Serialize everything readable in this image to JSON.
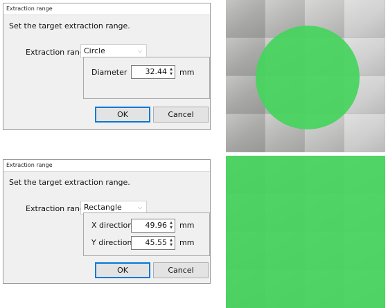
{
  "dialog_circle": {
    "title": "Extraction range",
    "instruction": "Set the target extraction range.",
    "range_label": "Extraction range:",
    "shape_selected": "Circle",
    "diameter_label": "Diameter",
    "diameter_value": "32.44",
    "unit": "mm",
    "ok_label": "OK",
    "cancel_label": "Cancel"
  },
  "dialog_rect": {
    "title": "Extraction range",
    "instruction": "Set the target extraction range.",
    "range_label": "Extraction range:",
    "shape_selected": "Rectangle",
    "x_label": "X direction",
    "x_value": "49.96",
    "y_label": "Y direction",
    "y_value": "45.55",
    "unit": "mm",
    "ok_label": "OK",
    "cancel_label": "Cancel"
  },
  "icons": {
    "chevron": "chevron-down-icon",
    "spin": "spin-up-down-icon"
  },
  "colors": {
    "highlight": "#45d45c",
    "dialog_bg": "#f0f0f0",
    "default_button_border": "#0078d7"
  }
}
